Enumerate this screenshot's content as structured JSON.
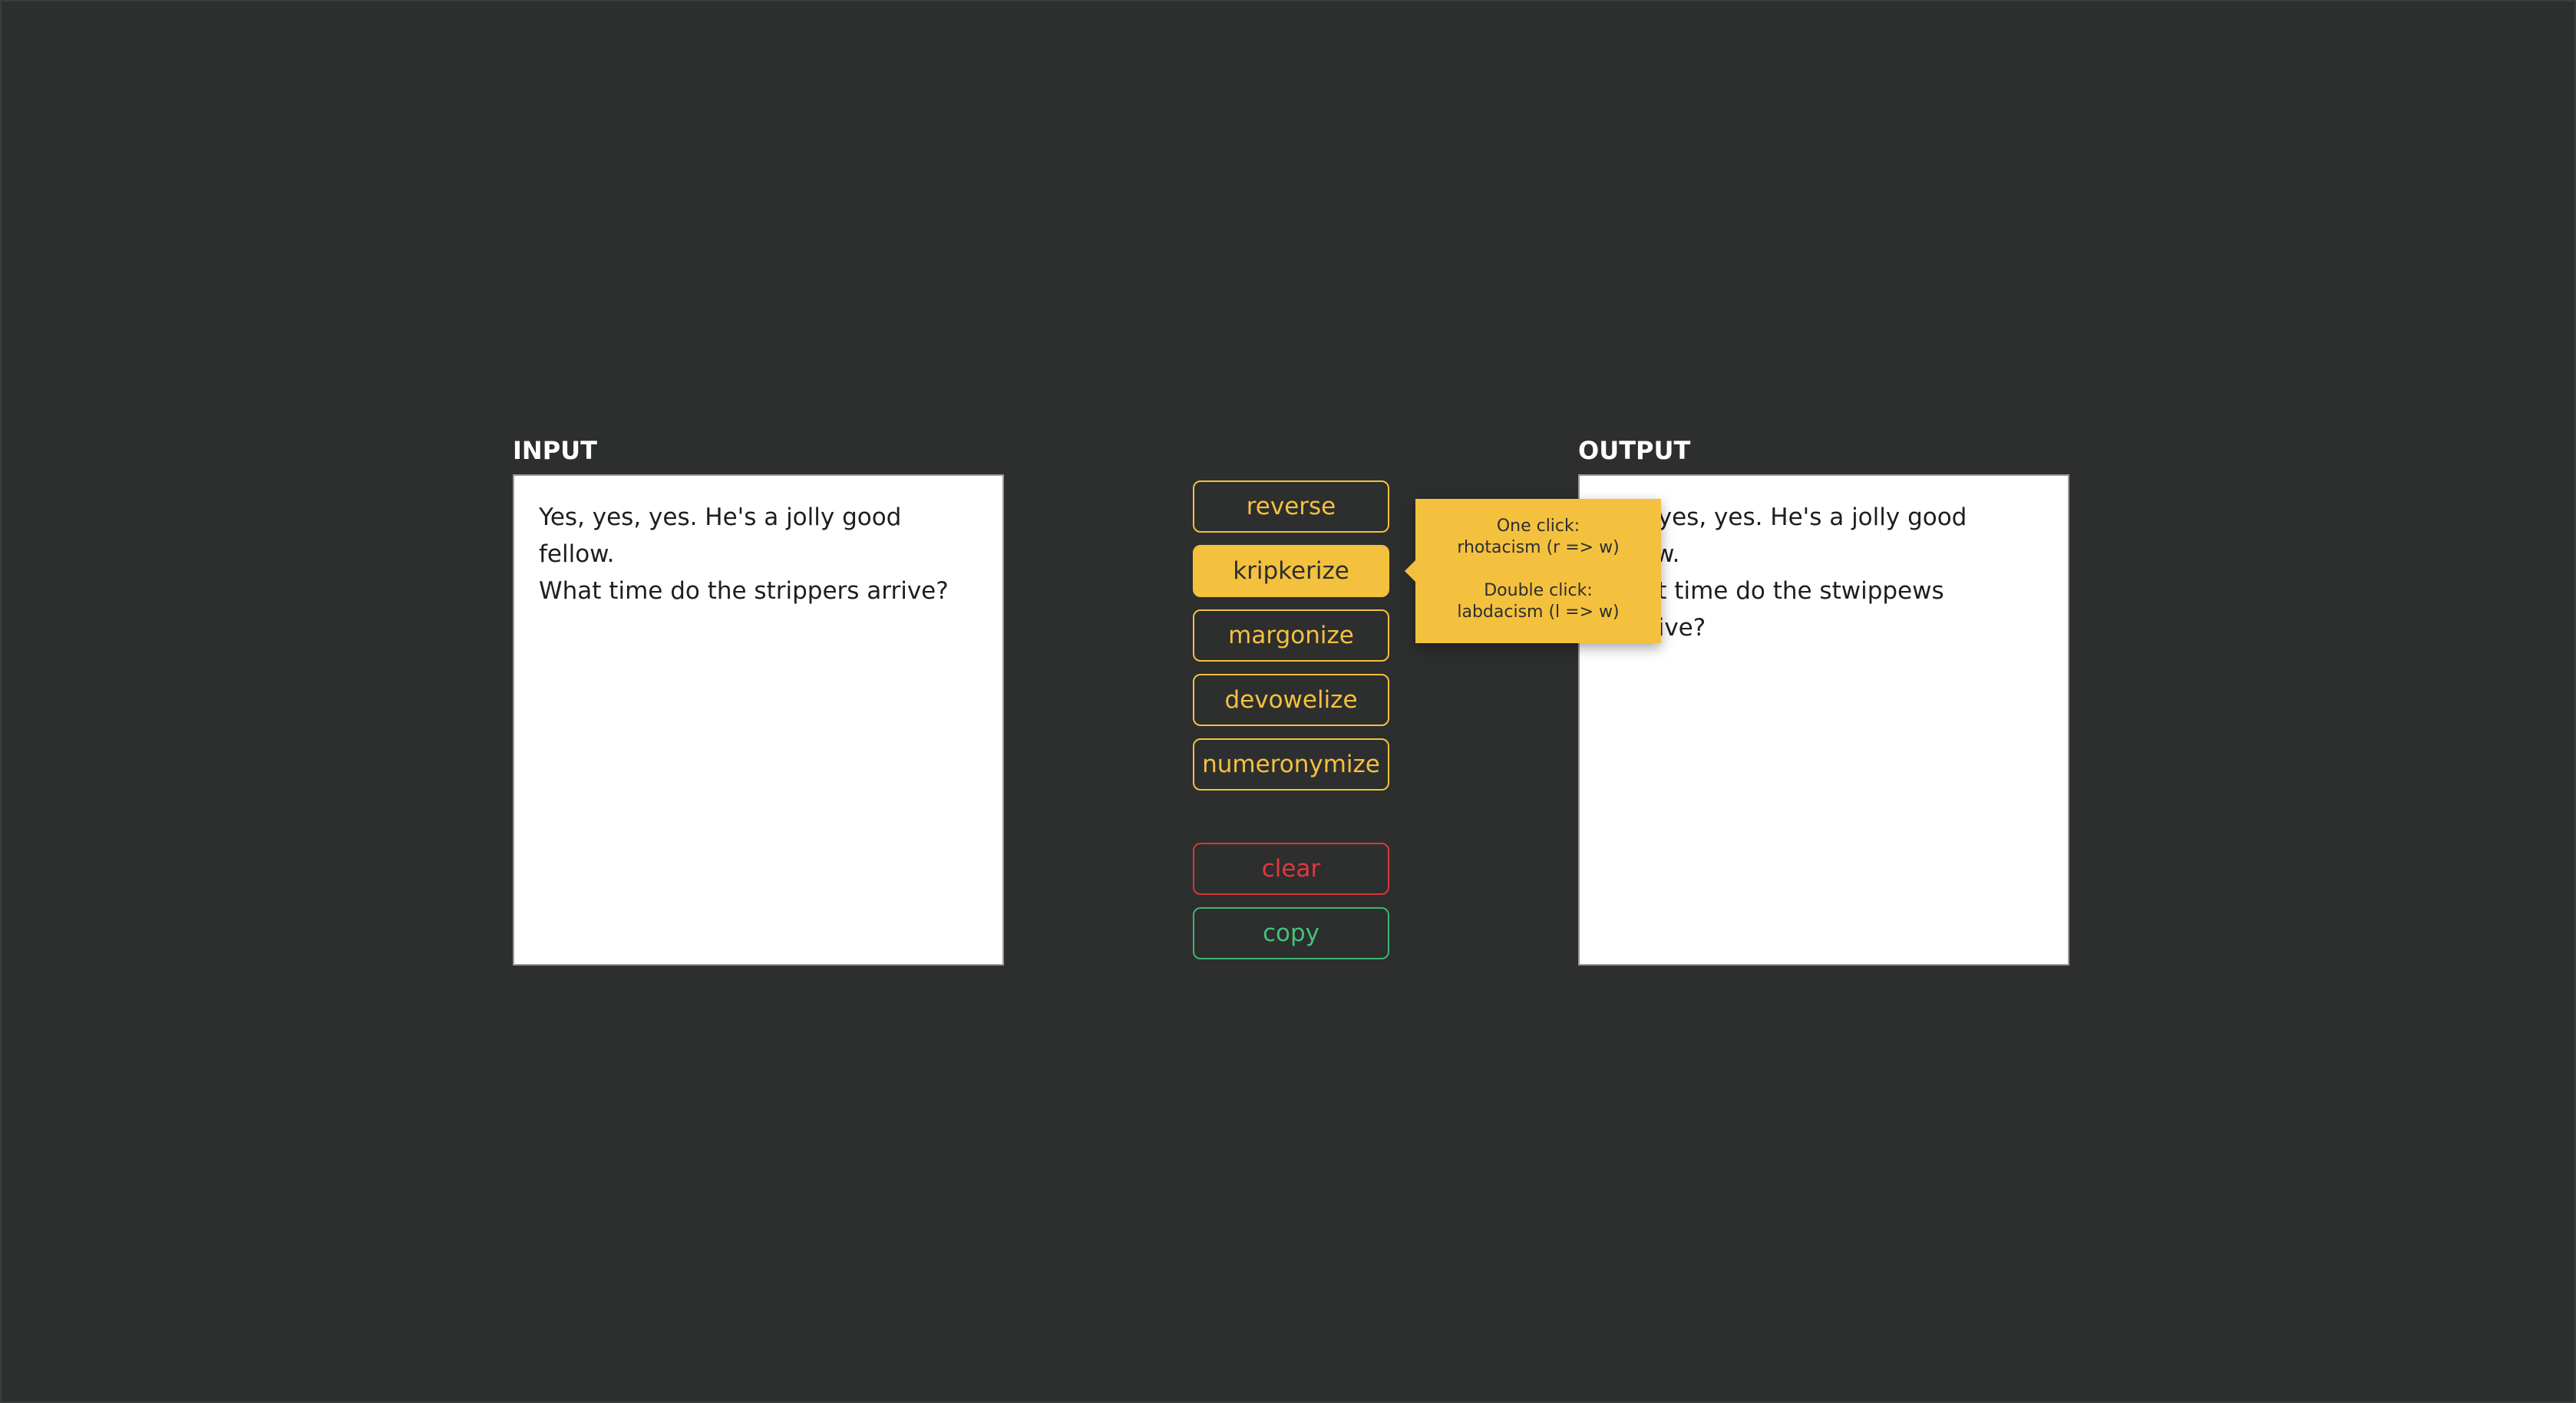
{
  "input": {
    "label": "INPUT",
    "text": "Yes, yes, yes. He's a jolly good fellow.\nWhat time do the strippers arrive?"
  },
  "output": {
    "label": "OUTPUT",
    "text": "Yes, yes, yes. He's a jolly good fellow.\nWhat time do the stwippews awwive?"
  },
  "buttons": {
    "reverse": "reverse",
    "kripkerize": "kripkerize",
    "margonize": "margonize",
    "devowelize": "devowelize",
    "numeronymize": "numeronymize",
    "clear": "clear",
    "copy": "copy"
  },
  "tooltip": {
    "one_click_title": "One click:",
    "one_click_desc": "rhotacism (r => w)",
    "double_click_title": "Double click:",
    "double_click_desc": "labdacism (l => w)"
  },
  "colors": {
    "background": "#2d2e2e",
    "accent": "#f4c13f",
    "danger": "#e0383b",
    "success": "#45c07a"
  }
}
